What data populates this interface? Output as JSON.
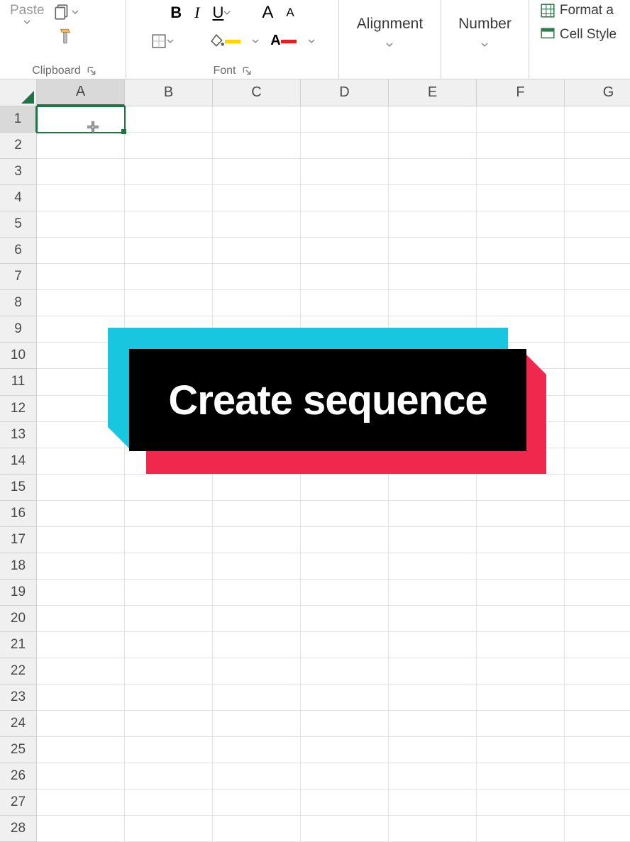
{
  "ribbon": {
    "clipboard": {
      "paste_label": "Paste",
      "group_label": "Clipboard"
    },
    "font": {
      "group_label": "Font",
      "bold": "B",
      "italic": "I",
      "underline": "U",
      "grow": "A",
      "shrink": "A"
    },
    "alignment": {
      "group_label": "Alignment"
    },
    "number": {
      "group_label": "Number"
    },
    "styles": {
      "format_as_table": "Format a",
      "cell_styles": "Cell Style"
    }
  },
  "grid": {
    "columns": [
      "A",
      "B",
      "C",
      "D",
      "E",
      "F",
      "G"
    ],
    "rows": [
      1,
      2,
      3,
      4,
      5,
      6,
      7,
      8,
      9,
      10,
      11,
      12,
      13,
      14,
      15,
      16,
      17,
      18,
      19,
      20,
      21,
      22,
      23,
      24,
      25,
      26,
      27,
      28
    ],
    "active_cell": "A1"
  },
  "overlay": {
    "text": "Create sequence",
    "colors": {
      "cyan": "#18c6df",
      "pink": "#f0284e",
      "black": "#000000"
    }
  }
}
